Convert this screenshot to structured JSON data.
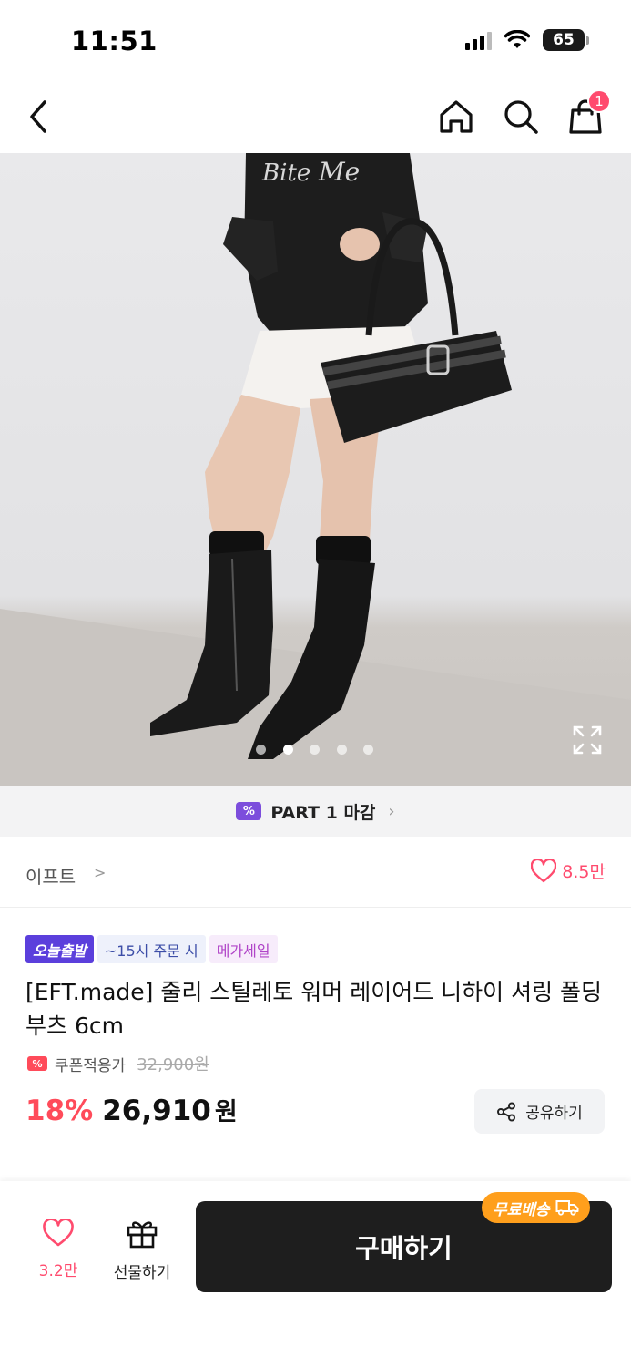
{
  "status_bar": {
    "time": "11:51",
    "battery": "65"
  },
  "nav": {
    "cart_count": "1"
  },
  "gallery": {
    "total_images": 5,
    "active_index": 1
  },
  "part_banner": {
    "label": "PART 1 마감",
    "icon_text": "%"
  },
  "brand": {
    "name": "이프트",
    "chevron": ">",
    "likes": "8.5만"
  },
  "badges": {
    "today_ship": "오늘출발",
    "time_limit": "~15시 주문 시",
    "mega_sale": "메가세일"
  },
  "product": {
    "title": "[EFT.made] 줄리 스틸레토 워머 레이어드 니하이 셔링 폴딩 부츠 6cm",
    "coupon_label": "쿠폰적용가",
    "original_price": "32,900원",
    "discount": "18%",
    "price": "26,910",
    "currency": "원"
  },
  "share": {
    "label": "공유하기"
  },
  "bottom_bar": {
    "like_count": "3.2만",
    "gift_label": "선물하기",
    "buy_label": "구매하기",
    "free_shipping": "무료배송"
  },
  "colors": {
    "accent_pink": "#ff4b6e",
    "discount_red": "#ff4b5a",
    "purple": "#7c4ddc",
    "free_ship_orange": "#ff9f1c",
    "buy_dark": "#1e1e1e"
  }
}
